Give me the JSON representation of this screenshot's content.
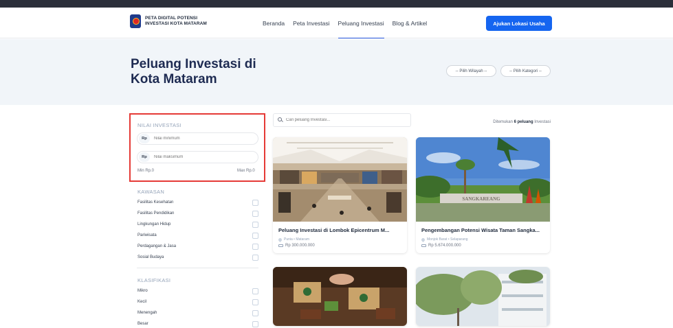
{
  "brand": {
    "line1": "PETA DIGITAL POTENSI",
    "line2": "INVESTASI KOTA MATARAM"
  },
  "nav": [
    "Beranda",
    "Peta Investasi",
    "Peluang Investasi",
    "Blog & Artikel"
  ],
  "nav_active": "Peluang Investasi",
  "cta_label": "Ajukan Lokasi Usaha",
  "hero": {
    "title_line1": "Peluang Investasi di",
    "title_line2": "Kota Mataram"
  },
  "filters": {
    "region": "-- Pilih Wilayah --",
    "category": "-- Pilih Kategori --"
  },
  "sidebar": {
    "nilai_title": "NILAI INVESTASI",
    "rp": "Rp",
    "min_placeholder": "Nilai minimum",
    "max_placeholder": "Nilai maksimum",
    "min_label": "Min Rp.0",
    "max_label": "Max Rp.0",
    "kawasan_title": "KAWASAN",
    "kawasan": [
      "Fasilitas Kesehatan",
      "Fasilitas Pendidikan",
      "Lingkungan Hidup",
      "Pariwisata",
      "Perdagangan & Jasa",
      "Sosial Budaya"
    ],
    "klasifikasi_title": "KLASIFIKASI",
    "klasifikasi": [
      "Mikro",
      "Kecil",
      "Menengah",
      "Besar"
    ]
  },
  "search_placeholder": "Cari peluang Investasi...",
  "result": {
    "prefix": "Ditemukan ",
    "count": "6 peluang",
    "suffix": " Investasi"
  },
  "cards": [
    {
      "title": "Peluang Investasi di Lombok Epicentrum M...",
      "location": "Punia • Mataram",
      "price": "Rp 300.000.000"
    },
    {
      "title": "Pengembangan Potensi Wisata Taman Sangka...",
      "location": "Monjok Barat • Selaparang",
      "price": "Rp 5.674.000.000"
    },
    {
      "title": "",
      "location": "",
      "price": ""
    },
    {
      "title": "",
      "location": "",
      "price": ""
    }
  ],
  "image_text": {
    "sangkareang": "SANGKAREANG"
  },
  "colors": {
    "primary": "#1565f0",
    "highlight": "#e53935",
    "heading": "#1e2b52"
  }
}
